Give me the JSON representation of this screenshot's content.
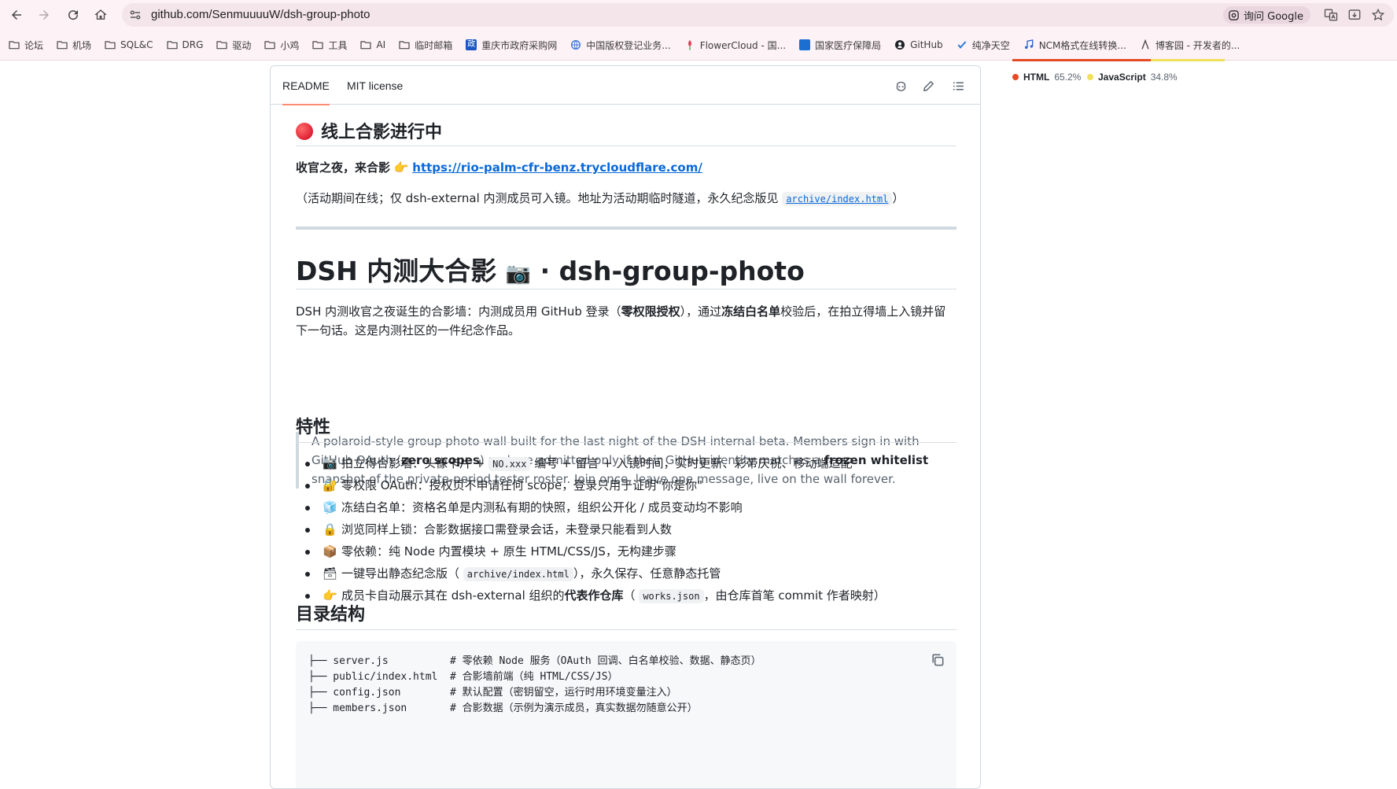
{
  "browser": {
    "url_host": "github.com",
    "url_path": "/SenmuuuuW/dsh-group-photo",
    "ask_google": "询问 Google",
    "bookmarks": [
      {
        "label": "论坛",
        "icon": "folder-icon"
      },
      {
        "label": "机场",
        "icon": "folder-icon"
      },
      {
        "label": "SQL&C",
        "icon": "folder-icon"
      },
      {
        "label": "DRG",
        "icon": "folder-icon"
      },
      {
        "label": "驱动",
        "icon": "folder-icon"
      },
      {
        "label": "小鸡",
        "icon": "folder-icon"
      },
      {
        "label": "工具",
        "icon": "folder-icon"
      },
      {
        "label": "AI",
        "icon": "folder-icon"
      },
      {
        "label": "临时邮箱",
        "icon": "folder-icon"
      },
      {
        "label": "重庆市政府采购网",
        "icon": "gov-icon"
      },
      {
        "label": "中国版权登记业务...",
        "icon": "globe-icon"
      },
      {
        "label": "FlowerCloud - 国...",
        "icon": "flower-icon"
      },
      {
        "label": "国家医疗保障局",
        "icon": "medical-icon"
      },
      {
        "label": "GitHub",
        "icon": "github-icon"
      },
      {
        "label": "纯净天空",
        "icon": "check-icon"
      },
      {
        "label": "NCM格式在线转换...",
        "icon": "music-icon"
      },
      {
        "label": "博客园 - 开发者的...",
        "icon": "blog-icon"
      }
    ]
  },
  "readme": {
    "tabs": [
      "README",
      "MIT license"
    ],
    "live_heading": "线上合影进行中",
    "live_lead": "收官之夜，来合影",
    "live_url": "https://rio-palm-cfr-benz.trycloudflare.com/",
    "live_note_pre": "（活动期间在线；仅 dsh-external 内测成员可入镜。地址为活动期临时隧道，永久纪念版见",
    "live_note_code": "archive/index.html",
    "live_note_post": "）",
    "title_pre": "DSH 内测大合影",
    "title_post": "· dsh-group-photo",
    "intro_1": "DSH 内测收官之夜诞生的合影墙：内测成员用 GitHub 登录（",
    "intro_b1": "零权限授权",
    "intro_2": "），通过",
    "intro_b2": "冻结白名单",
    "intro_3": "校验后，在拍立得墙上入镜并留下一句话。这是内测社区的一件纪念作品。",
    "quote_1": "A polaroid-style group photo wall built for the last night of the DSH internal beta. Members sign in with GitHub OAuth (",
    "quote_b1": "zero scopes",
    "quote_2": ") and are admitted only if their GitHub identity matches a ",
    "quote_b2": "frozen whitelist",
    "quote_3": " snapshot of the private-period tester roster. Join once, leave one message, live on the wall forever.",
    "features_heading": "特性",
    "features": [
      {
        "emoji": "📷",
        "a": "拍立得合影墙：头像卡片 + ",
        "code": "NO.xxx",
        "b": " 编号 + 留言 + 入镜时间，实时更新、彩带庆祝、移动端适配"
      },
      {
        "emoji": "🔐",
        "a": "零权限 OAuth：授权页不申请任何 scope，登录只用于证明\"你是你\"",
        "code": "",
        "b": ""
      },
      {
        "emoji": "🧊",
        "a": "冻结白名单：资格名单是内测私有期的快照，组织公开化 / 成员变动均不影响",
        "code": "",
        "b": ""
      },
      {
        "emoji": "🔒",
        "a": "浏览同样上锁：合影数据接口需登录会话，未登录只能看到人数",
        "code": "",
        "b": ""
      },
      {
        "emoji": "📦",
        "a": "零依赖：纯 Node 内置模块 + 原生 HTML/CSS/JS，无构建步骤",
        "code": "",
        "b": ""
      },
      {
        "emoji": "🗃",
        "a": "一键导出静态纪念版（",
        "code": "archive/index.html",
        "b": "），永久保存、任意静态托管"
      },
      {
        "emoji": "👉",
        "a": "成员卡自动展示其在 dsh-external 组织的",
        "bold": "代表作仓库",
        "a2": "（",
        "code": "works.json",
        "b": "，由仓库首笔 commit 作者映射）"
      }
    ],
    "tree_heading": "目录结构",
    "tree": [
      "├── server.js          # 零依赖 Node 服务（OAuth 回调、白名单校验、数据、静态页）",
      "├── public/index.html  # 合影墙前端（纯 HTML/CSS/JS）",
      "├── config.json        # 默认配置（密钥留空，运行时用环境变量注入）",
      "├── members.json       # 合影数据（示例为演示成员，真实数据勿随意公开）"
    ]
  },
  "languages": [
    {
      "name": "HTML",
      "percent": "65.2%",
      "color": "#e34c26",
      "share": 0.652
    },
    {
      "name": "JavaScript",
      "percent": "34.8%",
      "color": "#f1e05a",
      "share": 0.348
    }
  ]
}
